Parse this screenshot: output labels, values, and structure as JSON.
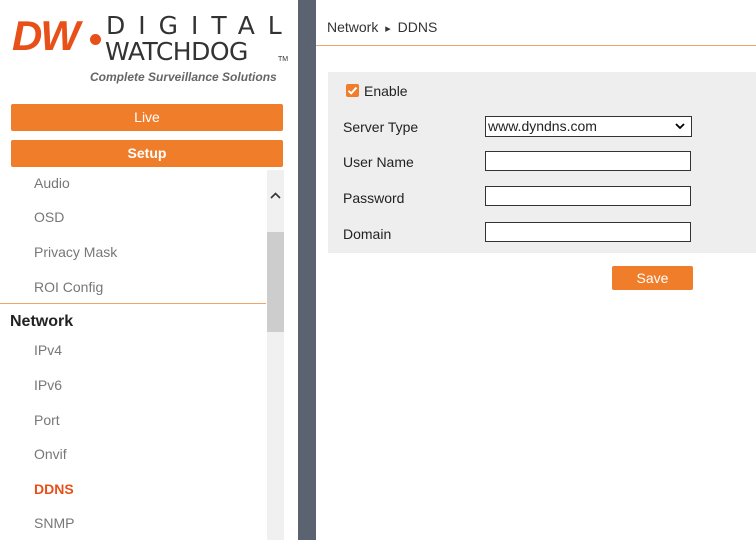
{
  "logo": {
    "brand_mark": "DW",
    "line1": "DIGITAL",
    "line2": "WATCHDOG",
    "trademark": "TM",
    "tagline": "Complete Surveillance Solutions",
    "accent_color": "#e8501a"
  },
  "nav": {
    "live_label": "Live",
    "setup_label": "Setup",
    "button_color": "#f07d2a"
  },
  "menu": {
    "items_before": [
      "Audio",
      "OSD",
      "Privacy Mask",
      "ROI Config"
    ],
    "section": "Network",
    "items_after": [
      "IPv4",
      "IPv6",
      "Port",
      "Onvif",
      "DDNS",
      "SNMP"
    ],
    "active_item": "DDNS",
    "active_color": "#e8501a"
  },
  "breadcrumb": {
    "parent": "Network",
    "separator": "▸",
    "current": "DDNS"
  },
  "form": {
    "enable_label": "Enable",
    "enable_checked": true,
    "server_type_label": "Server Type",
    "server_type_value": "www.dyndns.com",
    "user_name_label": "User Name",
    "user_name_value": "",
    "password_label": "Password",
    "password_value": "",
    "domain_label": "Domain",
    "domain_value": ""
  },
  "actions": {
    "save_label": "Save"
  }
}
